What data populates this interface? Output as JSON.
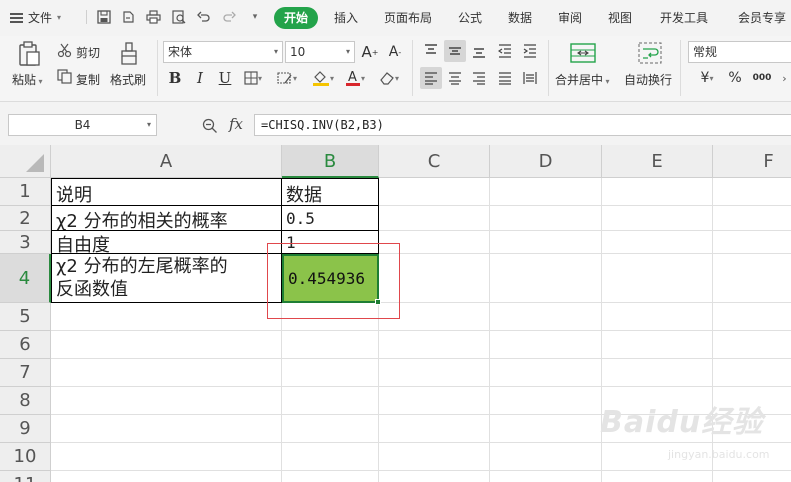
{
  "menu": {
    "file": "文件",
    "tabs": [
      {
        "label": "开始",
        "active": true
      },
      {
        "label": "插入"
      },
      {
        "label": "页面布局"
      },
      {
        "label": "公式"
      },
      {
        "label": "数据"
      },
      {
        "label": "审阅"
      },
      {
        "label": "视图"
      },
      {
        "label": "开发工具"
      },
      {
        "label": "会员专享"
      }
    ]
  },
  "ribbon": {
    "paste": "粘贴",
    "cut": "剪切",
    "copy": "复制",
    "format_painter": "格式刷",
    "font_name": "宋体",
    "font_size": "10",
    "merge_center": "合并居中",
    "wrap_text": "自动换行",
    "number_format": "常规",
    "percent": "%",
    "thousands": "000",
    "accent_color": "#23a34a"
  },
  "formula_bar": {
    "name_box": "B4",
    "fx": "fx",
    "formula": "=CHISQ.INV(B2,B3)"
  },
  "sheet": {
    "columns": [
      "A",
      "B",
      "C",
      "D",
      "E",
      "F"
    ],
    "rows": [
      "1",
      "2",
      "3",
      "4",
      "5",
      "6",
      "7",
      "8",
      "9",
      "10",
      "11"
    ],
    "cells": {
      "A1": "说明",
      "B1": "数据",
      "A2": "χ2 分布的相关的概率",
      "B2": "0.5",
      "A3": "自由度",
      "B3": "1",
      "A4_line1": "χ2 分布的左尾概率的",
      "A4_line2": "反函数值",
      "B4": "0.454936"
    },
    "selected_fill": "#8bc34a",
    "highlight_color": "#e0474c"
  },
  "watermark": {
    "brand": "Baidu经验",
    "url": "jingyan.baidu.com"
  }
}
